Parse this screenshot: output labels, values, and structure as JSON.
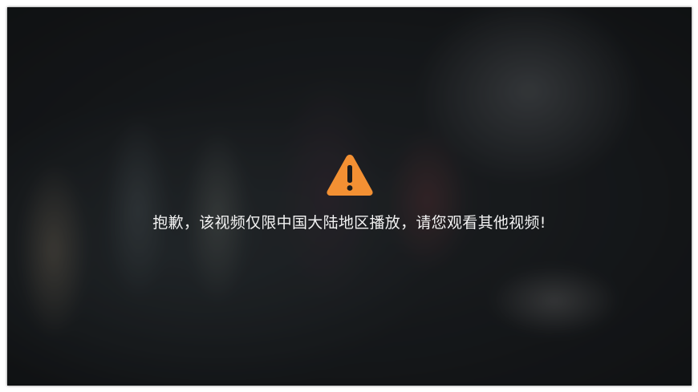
{
  "player": {
    "warning_icon": "warning-triangle-icon",
    "icon_color": "#f39033",
    "message": "抱歉，该视频仅限中国大陆地区播放，请您观看其他视频!"
  }
}
